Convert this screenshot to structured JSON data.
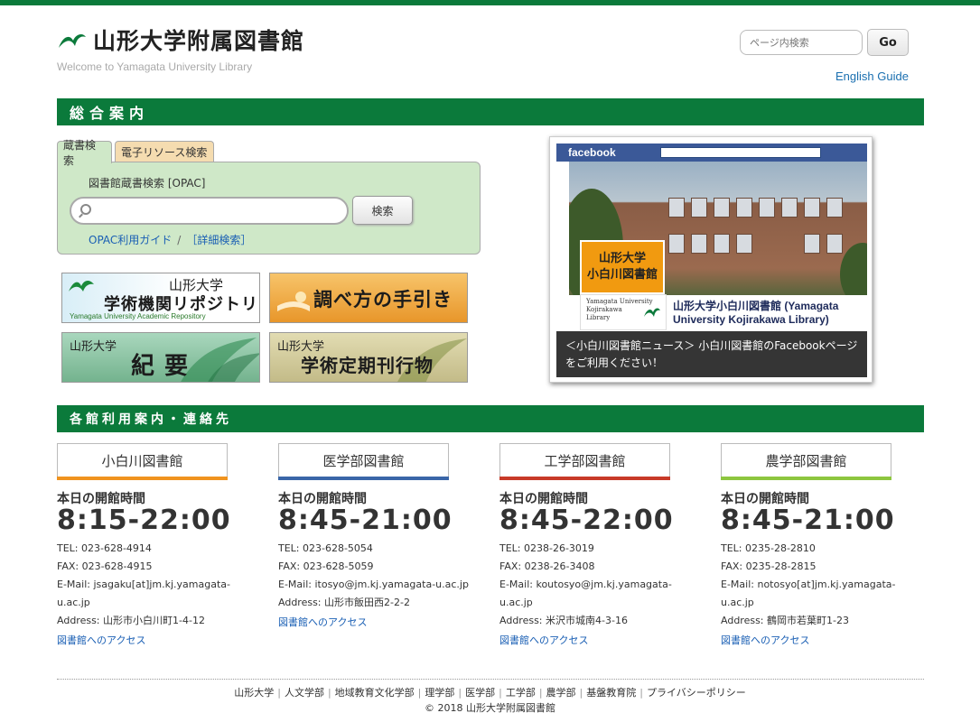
{
  "header": {
    "site_name": "山形大学附属図書館",
    "tagline": "Welcome to Yamagata University Library",
    "search_placeholder": "ページ内検索",
    "go_label": "Go",
    "english_guide": "English Guide"
  },
  "section1": {
    "title": "総合案内"
  },
  "search_box": {
    "tabs": [
      "蔵書検索",
      "電子リソース検索"
    ],
    "label": "図書館蔵書検索 [OPAC]",
    "button": "検索",
    "guide_link": "OPAC利用ガイド",
    "separator": "/",
    "advanced_link": "［詳細検索］"
  },
  "banners": {
    "repository": {
      "small": "山形大学",
      "big": "学術機関リポジトリ",
      "tiny": "Yamagata University Academic Repository"
    },
    "guide": {
      "big": "調べ方の手引き"
    },
    "bulletin": {
      "small": "山形大学",
      "big": "紀 要"
    },
    "periodicals": {
      "small": "山形大学",
      "big": "学術定期刊行物"
    }
  },
  "facebook": {
    "header": "facebook",
    "logo_text_1": "山形大学",
    "logo_text_2": "小白川図書館",
    "card_lines": [
      "Yamagata University",
      "Kojirakawa",
      "Library"
    ],
    "page_name": "山形大学小白川図書館 (Yamagata University Kojirakawa Library)",
    "caption": "＜小白川図書館ニュース＞ 小白川図書館のFacebookページをご利用ください！"
  },
  "section2": {
    "title": "各館利用案内・連絡先"
  },
  "branches": [
    {
      "name": "小白川図書館",
      "color": "#f0931e",
      "hours_label": "本日の開館時間",
      "hours": "8:15-22:00",
      "tel": "TEL: 023-628-4914",
      "fax": "FAX: 023-628-4915",
      "email": "E-Mail: jsagaku[at]jm.kj.yamagata-u.ac.jp",
      "address": "Address: 山形市小白川町1-4-12",
      "access": "図書館へのアクセス"
    },
    {
      "name": "医学部図書館",
      "color": "#3a66a8",
      "hours_label": "本日の開館時間",
      "hours": "8:45-21:00",
      "tel": "TEL: 023-628-5054",
      "fax": "FAX: 023-628-5059",
      "email": "E-Mail: itosyo@jm.kj.yamagata-u.ac.jp",
      "address": "Address: 山形市飯田西2-2-2",
      "access": "図書館へのアクセス"
    },
    {
      "name": "工学部図書館",
      "color": "#c83a28",
      "hours_label": "本日の開館時間",
      "hours": "8:45-22:00",
      "tel": "TEL: 0238-26-3019",
      "fax": "FAX: 0238-26-3408",
      "email": "E-Mail: koutosyo@jm.kj.yamagata-u.ac.jp",
      "address": "Address: 米沢市城南4-3-16",
      "access": "図書館へのアクセス"
    },
    {
      "name": "農学部図書館",
      "color": "#8dc63f",
      "hours_label": "本日の開館時間",
      "hours": "8:45-21:00",
      "tel": "TEL: 0235-28-2810",
      "fax": "FAX: 0235-28-2815",
      "email": "E-Mail: notosyo[at]jm.kj.yamagata-u.ac.jp",
      "address": "Address: 鶴岡市若葉町1-23",
      "access": "図書館へのアクセス"
    }
  ],
  "footer": {
    "links": [
      "山形大学",
      "人文学部",
      "地域教育文化学部",
      "理学部",
      "医学部",
      "工学部",
      "農学部",
      "基盤教育院",
      "プライバシーポリシー"
    ],
    "copyright": "© 2018 山形大学附属図書館"
  },
  "colors": {
    "brand_green": "#0b7a3b",
    "link_blue": "#1a5fb4"
  }
}
